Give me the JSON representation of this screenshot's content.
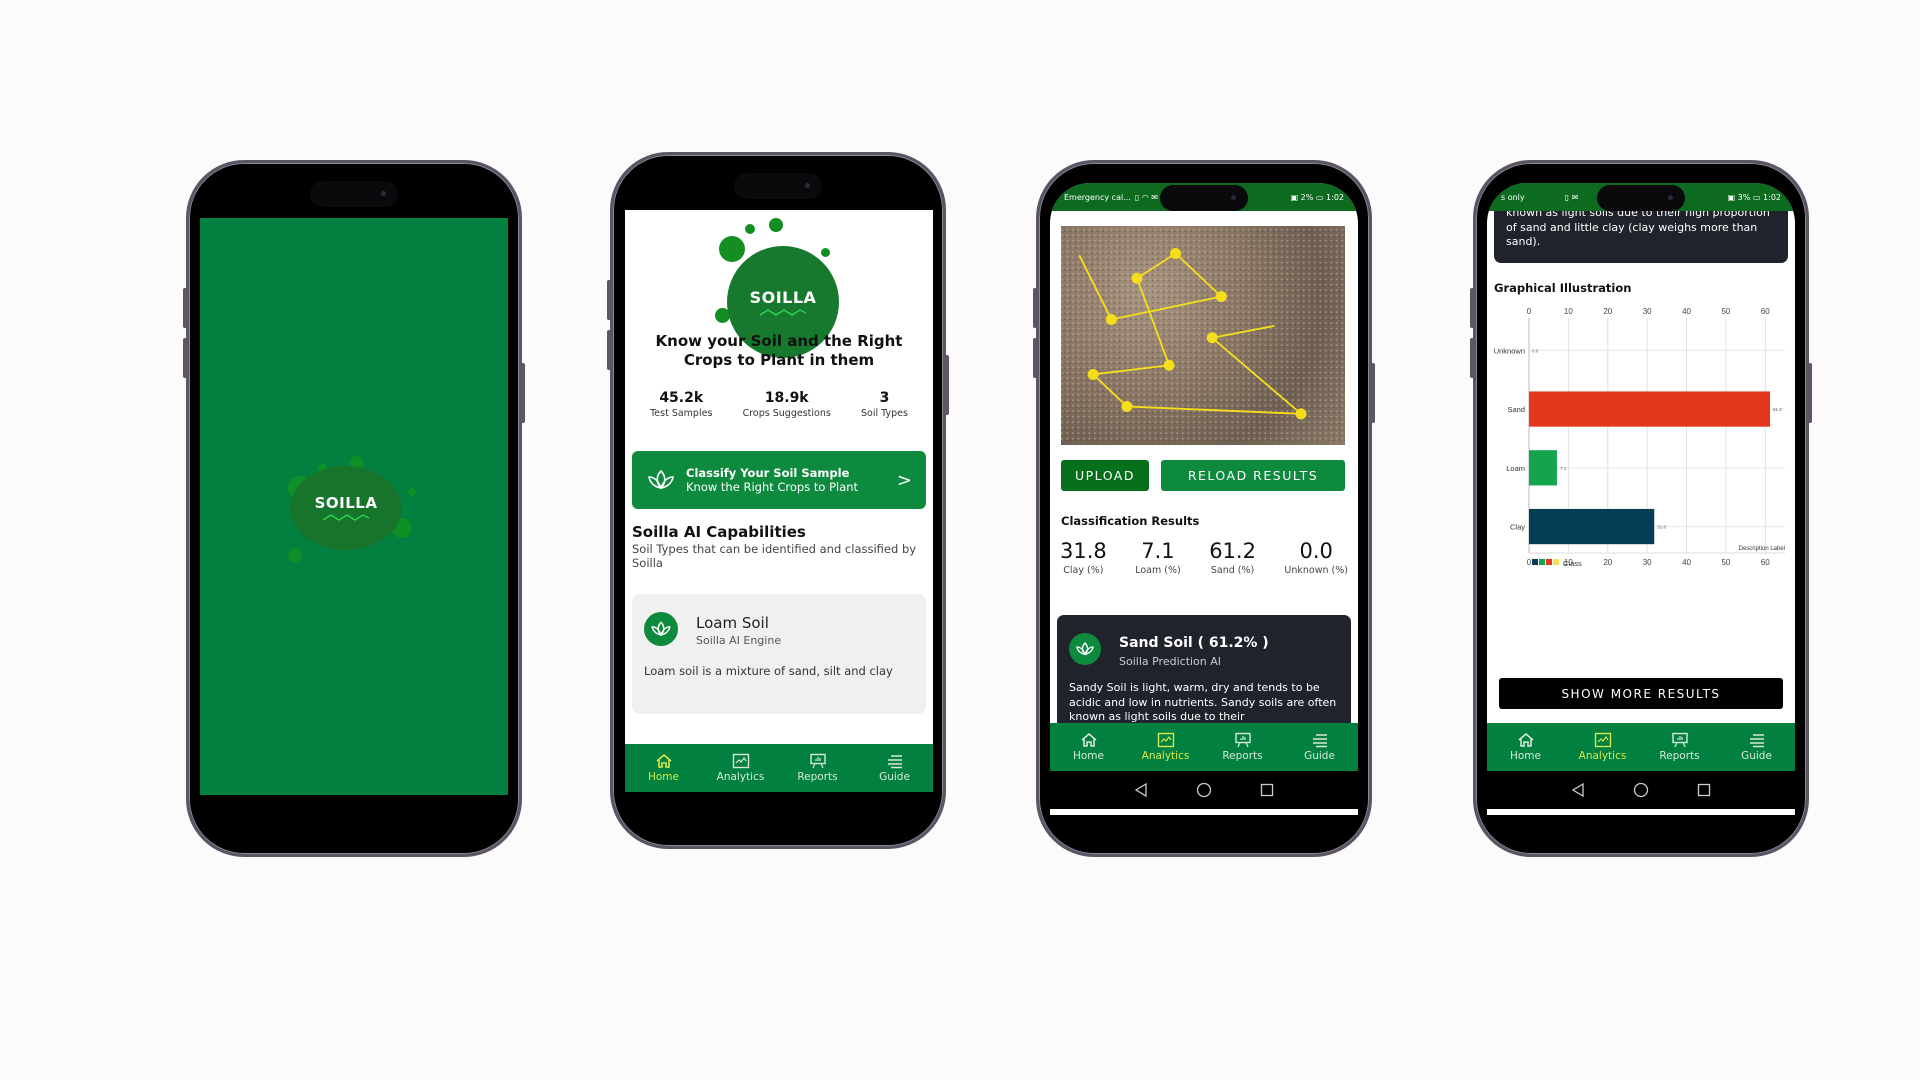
{
  "app": {
    "name": "SOILLA"
  },
  "splash": {
    "logo_text": "SOILLA"
  },
  "home": {
    "logo_text": "SOILLA",
    "headline": "Know your Soil and the Right Crops to Plant in them",
    "stats": [
      {
        "value": "45.2k",
        "label": "Test Samples"
      },
      {
        "value": "18.9k",
        "label": "Crops Suggestions"
      },
      {
        "value": "3",
        "label": "Soil Types"
      }
    ],
    "cta": {
      "title": "Classify Your Soil Sample",
      "subtitle": "Know the Right Crops to Plant",
      "icon": "lotus-leaf-icon",
      "chevron": ">"
    },
    "capabilities": {
      "title": "Soilla AI Capabilities",
      "subtitle": "Soil Types that can be identified and classified by Soilla"
    },
    "soil_card": {
      "title": "Loam Soil",
      "subtitle": "Soilla AI Engine",
      "body": "Loam soil is a mixture of sand, silt and clay"
    }
  },
  "tabs": [
    {
      "label": "Home",
      "icon": "home-icon"
    },
    {
      "label": "Analytics",
      "icon": "analytics-icon"
    },
    {
      "label": "Reports",
      "icon": "reports-icon"
    },
    {
      "label": "Guide",
      "icon": "guide-icon"
    }
  ],
  "analytics": {
    "status_bar": {
      "left": "Emergency cal...",
      "battery": "2%",
      "time": "1:02"
    },
    "upload_label": "UPLOAD",
    "reload_label": "RELOAD RESULTS",
    "results_title": "Classification Results",
    "results": [
      {
        "value": "31.8",
        "label": "Clay (%)"
      },
      {
        "value": "7.1",
        "label": "Loam (%)"
      },
      {
        "value": "61.2",
        "label": "Sand (%)"
      },
      {
        "value": "0.0",
        "label": "Unknown (%)"
      }
    ],
    "prediction": {
      "title": "Sand Soil ( 61.2% )",
      "subtitle": "Soilla Prediction AI",
      "body": "Sandy Soil is light, warm, dry and tends to be acidic and low in nutrients. Sandy soils are often known as light soils due to their"
    }
  },
  "analytics_scrolled": {
    "status_bar": {
      "left": "s only",
      "battery": "3%",
      "time": "1:02"
    },
    "prediction_body": "Sandy Soil is light, warm, dry and tends to be acidic and low in nutrients. Sandy soils are often known as light soils due to their high proportion of sand and little clay (clay weighs more than sand).",
    "graph_title": "Graphical Illustration",
    "show_more_label": "SHOW MORE RESULTS"
  },
  "colors": {
    "brand_green": "#018040",
    "active_tab": "#d7e84a",
    "clay": "#053d55",
    "loam": "#14a44b",
    "sand": "#e3371e",
    "unknown": "#f7e04b"
  },
  "chart_data": {
    "type": "bar",
    "orientation": "horizontal",
    "title": "Graphical Illustration",
    "categories": [
      "Unknown",
      "Sand",
      "Loam",
      "Clay"
    ],
    "values": [
      0.0,
      61.2,
      7.1,
      31.8
    ],
    "value_labels": [
      "0.0",
      "61.2",
      "7.1",
      "31.8"
    ],
    "colors": [
      "#f7e04b",
      "#e3371e",
      "#14a44b",
      "#053d55"
    ],
    "xlim": [
      0,
      65
    ],
    "xticks": [
      0,
      10,
      20,
      30,
      40,
      50,
      60
    ],
    "xlabel": "Description Label",
    "grid": true,
    "legend": {
      "title": "Class",
      "placement": "bottom-left",
      "swatches": [
        "#053d55",
        "#14a44b",
        "#e3371e",
        "#f7e04b"
      ]
    }
  }
}
